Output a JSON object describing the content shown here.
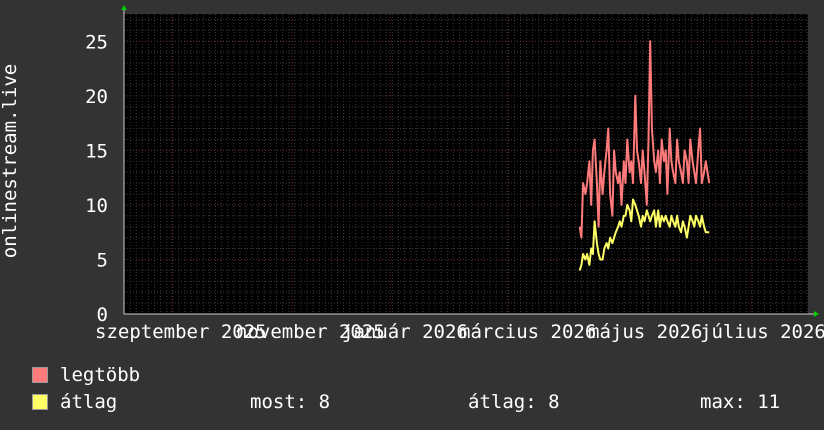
{
  "colors": {
    "background": "#333333",
    "canvas": "#000000",
    "grid_minor": "#3a3a3a",
    "grid_major": "#5a2a2a",
    "axis": "#cccccc",
    "arrow": "#00cc00",
    "max_series": "#ff7a7a",
    "avg_series": "#ffff66"
  },
  "legend": {
    "max_label": "legtöbb",
    "avg_label": "átlag"
  },
  "stats": {
    "now": "most: 8",
    "avg": "átlag: 8",
    "max": "max: 11"
  },
  "chart_data": {
    "type": "line",
    "ylabel": "onlinestream.live",
    "ylim": [
      0,
      27.5
    ],
    "yticks": [
      "0",
      "5",
      "10",
      "15",
      "20",
      "25"
    ],
    "xticks": [
      "szeptember 2025",
      "november 2025",
      "január 2026",
      "március 2026",
      "május 2026",
      "július 2026"
    ],
    "grid": true,
    "series": [
      {
        "name": "legtöbb",
        "color": "#ff7a7a",
        "values": [
          [
            0.795,
            8
          ],
          [
            0.798,
            7
          ],
          [
            0.801,
            12
          ],
          [
            0.805,
            11
          ],
          [
            0.808,
            12
          ],
          [
            0.812,
            14
          ],
          [
            0.815,
            10
          ],
          [
            0.818,
            15
          ],
          [
            0.821,
            16
          ],
          [
            0.825,
            12
          ],
          [
            0.828,
            8
          ],
          [
            0.831,
            14
          ],
          [
            0.835,
            11
          ],
          [
            0.838,
            13
          ],
          [
            0.842,
            15
          ],
          [
            0.845,
            17
          ],
          [
            0.848,
            11
          ],
          [
            0.852,
            9
          ],
          [
            0.855,
            15
          ],
          [
            0.858,
            13
          ],
          [
            0.862,
            12
          ],
          [
            0.865,
            13
          ],
          [
            0.868,
            10
          ],
          [
            0.872,
            14
          ],
          [
            0.875,
            12
          ],
          [
            0.878,
            16
          ],
          [
            0.882,
            13
          ],
          [
            0.885,
            14
          ],
          [
            0.888,
            12
          ],
          [
            0.892,
            20
          ],
          [
            0.895,
            15
          ],
          [
            0.898,
            14
          ],
          [
            0.902,
            12
          ],
          [
            0.905,
            15
          ],
          [
            0.908,
            13
          ],
          [
            0.912,
            10
          ],
          [
            0.915,
            16
          ],
          [
            0.918,
            25
          ],
          [
            0.921,
            17
          ],
          [
            0.925,
            14
          ],
          [
            0.928,
            13
          ],
          [
            0.932,
            15
          ],
          [
            0.935,
            12
          ],
          [
            0.938,
            16
          ],
          [
            0.942,
            14
          ],
          [
            0.945,
            15
          ],
          [
            0.948,
            11
          ],
          [
            0.952,
            17
          ],
          [
            0.955,
            14
          ],
          [
            0.958,
            13
          ],
          [
            0.962,
            12
          ],
          [
            0.965,
            16
          ],
          [
            0.968,
            14
          ],
          [
            0.972,
            13
          ],
          [
            0.975,
            12
          ],
          [
            0.978,
            15
          ],
          [
            0.982,
            14
          ],
          [
            0.985,
            12
          ],
          [
            0.988,
            16
          ],
          [
            0.992,
            14
          ],
          [
            0.995,
            13
          ],
          [
            0.998,
            12
          ],
          [
            1.002,
            15
          ],
          [
            1.005,
            17
          ],
          [
            1.008,
            12
          ],
          [
            1.012,
            13
          ],
          [
            1.015,
            14
          ],
          [
            1.018,
            13
          ],
          [
            1.021,
            12
          ]
        ]
      },
      {
        "name": "átlag",
        "color": "#ffff66",
        "values": [
          [
            0.795,
            4
          ],
          [
            0.798,
            4.5
          ],
          [
            0.801,
            5.5
          ],
          [
            0.805,
            5
          ],
          [
            0.808,
            5.5
          ],
          [
            0.812,
            4.5
          ],
          [
            0.815,
            6
          ],
          [
            0.818,
            5.5
          ],
          [
            0.821,
            8.5
          ],
          [
            0.825,
            6.5
          ],
          [
            0.828,
            5.5
          ],
          [
            0.831,
            5
          ],
          [
            0.835,
            5
          ],
          [
            0.838,
            6
          ],
          [
            0.842,
            6.5
          ],
          [
            0.845,
            6
          ],
          [
            0.848,
            7
          ],
          [
            0.852,
            6.5
          ],
          [
            0.855,
            7
          ],
          [
            0.858,
            7.5
          ],
          [
            0.862,
            8
          ],
          [
            0.865,
            8.5
          ],
          [
            0.868,
            8
          ],
          [
            0.872,
            9
          ],
          [
            0.875,
            9
          ],
          [
            0.878,
            10
          ],
          [
            0.882,
            9.5
          ],
          [
            0.885,
            8.5
          ],
          [
            0.888,
            10.5
          ],
          [
            0.892,
            10
          ],
          [
            0.895,
            9.5
          ],
          [
            0.898,
            9
          ],
          [
            0.902,
            8
          ],
          [
            0.905,
            9
          ],
          [
            0.908,
            8.5
          ],
          [
            0.912,
            9.5
          ],
          [
            0.915,
            9
          ],
          [
            0.918,
            8.5
          ],
          [
            0.921,
            9
          ],
          [
            0.925,
            9.5
          ],
          [
            0.928,
            8
          ],
          [
            0.932,
            9.5
          ],
          [
            0.935,
            8
          ],
          [
            0.938,
            9
          ],
          [
            0.942,
            8.5
          ],
          [
            0.945,
            9
          ],
          [
            0.948,
            8.5
          ],
          [
            0.952,
            8
          ],
          [
            0.955,
            9
          ],
          [
            0.958,
            8.5
          ],
          [
            0.962,
            8
          ],
          [
            0.965,
            9
          ],
          [
            0.968,
            8
          ],
          [
            0.972,
            7.5
          ],
          [
            0.975,
            8.5
          ],
          [
            0.978,
            8
          ],
          [
            0.982,
            7
          ],
          [
            0.985,
            8
          ],
          [
            0.988,
            9
          ],
          [
            0.992,
            8.5
          ],
          [
            0.995,
            8
          ],
          [
            0.998,
            9
          ],
          [
            1.002,
            8.5
          ],
          [
            1.005,
            8
          ],
          [
            1.008,
            9
          ],
          [
            1.012,
            8
          ],
          [
            1.015,
            7.5
          ],
          [
            1.018,
            7.5
          ],
          [
            1.021,
            7.5
          ]
        ]
      }
    ]
  }
}
